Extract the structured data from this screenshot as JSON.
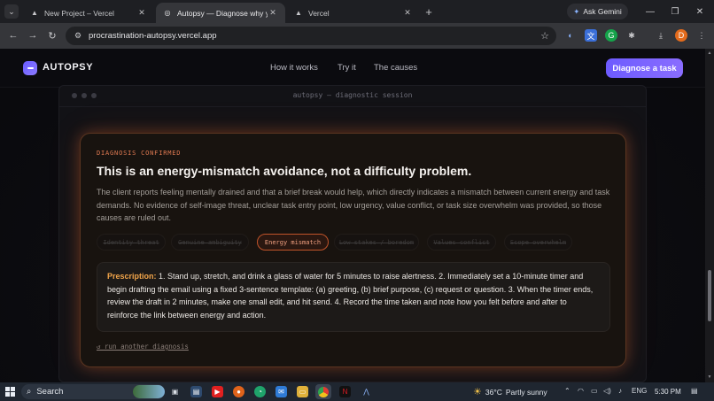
{
  "browser": {
    "tabs": [
      {
        "title": "New Project – Vercel",
        "active": false
      },
      {
        "title": "Autopsy — Diagnose why you'r",
        "active": true
      },
      {
        "title": "Vercel",
        "active": false
      }
    ],
    "ask_gemini": "Ask Gemini",
    "url": "procrastination-autopsy.vercel.app",
    "profile_initial": "D"
  },
  "site": {
    "brand": "AUTOPSY",
    "nav": [
      "How it works",
      "Try it",
      "The causes"
    ],
    "cta": "Diagnose a task"
  },
  "terminal": {
    "title": "autopsy — diagnostic session"
  },
  "result": {
    "eyebrow": "DIAGNOSIS CONFIRMED",
    "headline": "This is an energy-mismatch avoidance, not a difficulty problem.",
    "explanation": "The client reports feeling mentally drained and that a brief break would help, which directly indicates a mismatch between current energy and task demands. No evidence of self-image threat, unclear task entry point, low urgency, value conflict, or task size overwhelm was provided, so those causes are ruled out.",
    "causes": [
      {
        "label": "Identity threat",
        "active": false
      },
      {
        "label": "Genuine ambiguity",
        "active": false
      },
      {
        "label": "Energy mismatch",
        "active": true
      },
      {
        "label": "Low stakes / boredom",
        "active": false
      },
      {
        "label": "Values conflict",
        "active": false
      },
      {
        "label": "Scope overwhelm",
        "active": false
      }
    ],
    "prescription_label": "Prescription:",
    "prescription_text": " 1. Stand up, stretch, and drink a glass of water for 5 minutes to raise alertness. 2. Immediately set a 10-minute timer and begin drafting the email using a fixed 3-sentence template: (a) greeting, (b) brief purpose, (c) request or question. 3. When the timer ends, review the draft in 2 minutes, make one small edit, and hit send. 4. Record the time taken and note how you felt before and after to reinforce the link between energy and action.",
    "rerun": "↺ run another diagnosis"
  },
  "taskbar": {
    "search": "Search",
    "temperature": "36°C",
    "condition": "Partly sunny",
    "language": "ENG",
    "time": "5:30 PM"
  },
  "colors": {
    "accent": "#7a62ff",
    "warning": "#e07a52",
    "prescription": "#f2a54a"
  }
}
